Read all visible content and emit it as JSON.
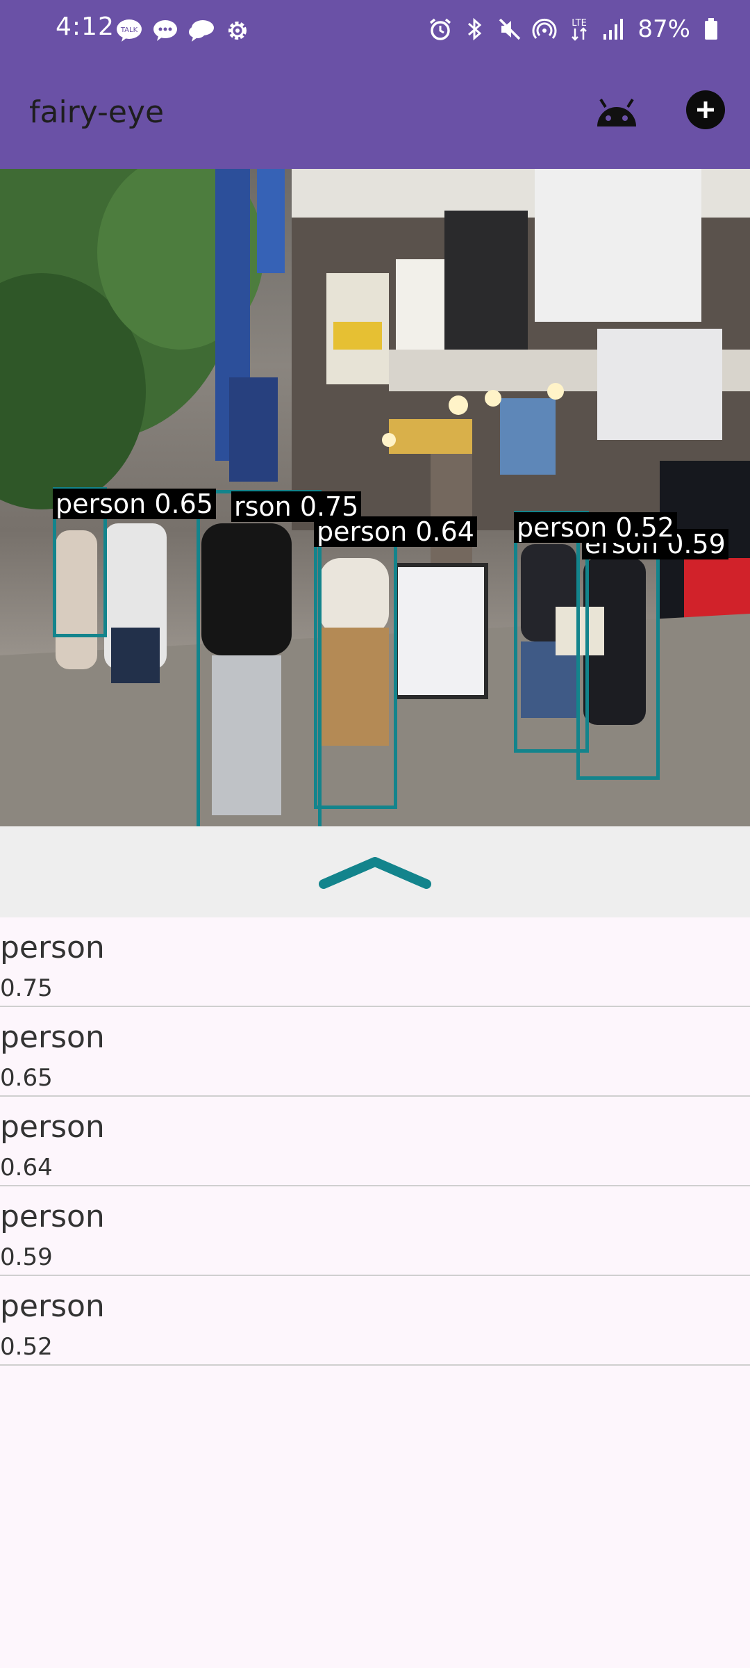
{
  "status_bar": {
    "time": "4:12",
    "battery": "87%",
    "left_icons": [
      "talk-icon",
      "chat-icon",
      "message-icon",
      "settings-icon"
    ],
    "right_icons": [
      "alarm-icon",
      "bluetooth-icon",
      "mute-icon",
      "hotspot-icon",
      "lte-icon",
      "signal-icon",
      "battery-icon"
    ]
  },
  "app_bar": {
    "title": "fairy-eye",
    "colors": {
      "background": "#6a51a6",
      "title": "#1e1e1e"
    }
  },
  "detections_overlay": [
    {
      "label": "person 0.65"
    },
    {
      "label": "rson 0.75"
    },
    {
      "label": "person 0.64"
    },
    {
      "label": "person 0.52"
    },
    {
      "label": "erson 0.59"
    }
  ],
  "results": [
    {
      "label": "person",
      "score": "0.75"
    },
    {
      "label": "person",
      "score": "0.65"
    },
    {
      "label": "person",
      "score": "0.64"
    },
    {
      "label": "person",
      "score": "0.59"
    },
    {
      "label": "person",
      "score": "0.52"
    }
  ],
  "colors": {
    "box": "#13848c",
    "handle_bg": "#eeeeee",
    "list_bg": "#fdf6fc"
  }
}
